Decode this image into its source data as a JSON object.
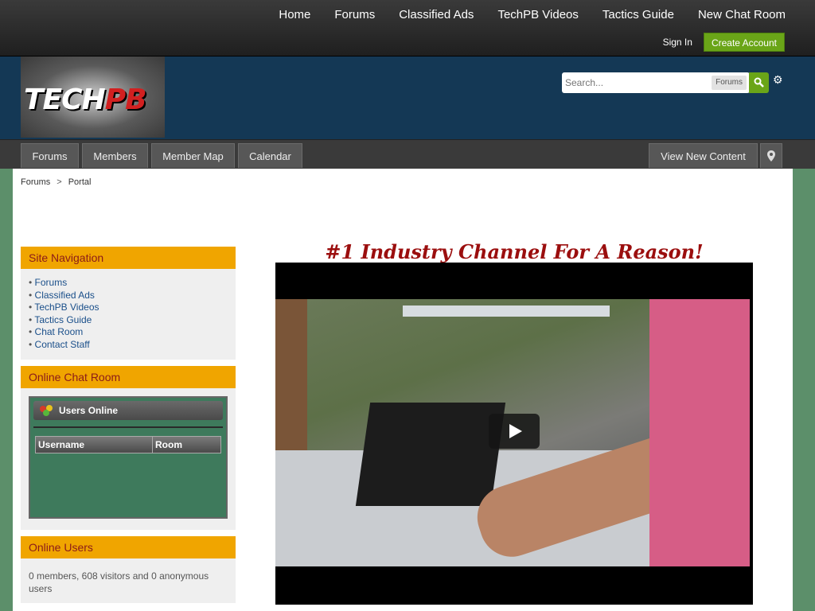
{
  "top_nav": [
    "Home",
    "Forums",
    "Classified Ads",
    "TechPB Videos",
    "Tactics Guide",
    "New Chat Room"
  ],
  "user_links": {
    "sign_in": "Sign In",
    "create_account": "Create Account"
  },
  "logo": {
    "text_main": "TECH",
    "text_accent": "PB"
  },
  "search": {
    "placeholder": "Search...",
    "scope": "Forums"
  },
  "tabs": [
    "Forums",
    "Members",
    "Member Map",
    "Calendar"
  ],
  "right_tabs": {
    "view_new": "View New Content"
  },
  "breadcrumb": {
    "items": [
      "Forums",
      "Portal"
    ],
    "separator": ">"
  },
  "sidebar": {
    "site_nav": {
      "title": "Site Navigation",
      "items": [
        "Forums",
        "Classified Ads",
        "TechPB Videos",
        "Tactics Guide",
        "Chat Room",
        "Contact Staff"
      ]
    },
    "chat": {
      "title": "Online Chat Room",
      "header": "Users Online",
      "columns": [
        "Username",
        "Room"
      ]
    },
    "online_users": {
      "title": "Online Users",
      "text": "0 members, 608 visitors and 0 anonymous users"
    }
  },
  "main": {
    "headline": "#1 Industry Channel For A Reason!"
  },
  "colors": {
    "accent_green": "#6aa518",
    "block_header": "#f0a500",
    "headline": "#9b0e0e",
    "brand_blue": "#143855"
  }
}
